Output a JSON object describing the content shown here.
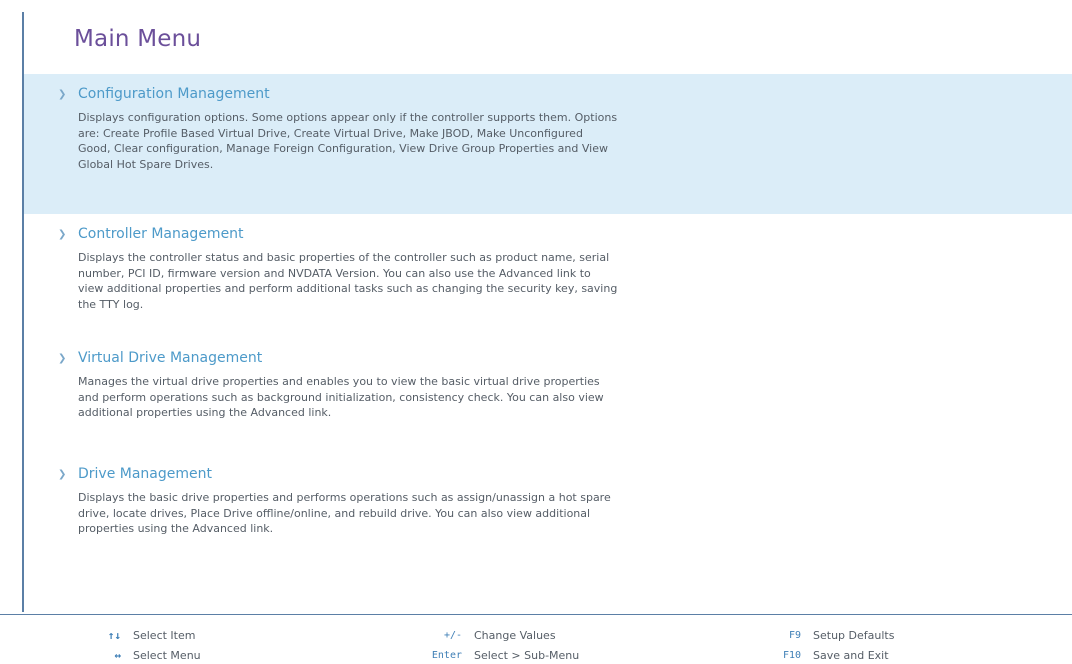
{
  "page": {
    "title": "Main Menu"
  },
  "menu": {
    "items": [
      {
        "label": "Configuration Management",
        "description": "Displays configuration options. Some options appear only if the controller supports them. Options are: Create Profile Based Virtual Drive, Create Virtual Drive, Make JBOD, Make Unconfigured Good, Clear configuration, Manage Foreign Configuration, View Drive Group Properties and View Global Hot Spare Drives.",
        "selected": true
      },
      {
        "label": "Controller Management",
        "description": "Displays the controller status and basic properties of the controller such as product name, serial number, PCI ID, firmware version and NVDATA Version. You can also use the Advanced link to view additional properties and perform additional tasks such as changing the security key, saving the TTY log.",
        "selected": false
      },
      {
        "label": "Virtual Drive Management",
        "description": "Manages the virtual drive properties and enables you to view the basic virtual drive properties and perform operations such as background initialization, consistency check. You can also view additional properties using the Advanced link.",
        "selected": false
      },
      {
        "label": "Drive Management",
        "description": "Displays the basic drive properties and performs operations such as assign/unassign a hot spare drive, locate drives, Place Drive offline/online, and rebuild drive. You can also view additional properties using the Advanced link.",
        "selected": false
      }
    ]
  },
  "footer": {
    "hints": [
      {
        "key": "↑↓",
        "text": "Select Item"
      },
      {
        "key": "↔",
        "text": "Select Menu"
      },
      {
        "key": "+/-",
        "text": "Change Values"
      },
      {
        "key": "Enter",
        "text": "Select > Sub-Menu"
      },
      {
        "key": "F9",
        "text": "Setup Defaults"
      },
      {
        "key": "F10",
        "text": "Save and Exit"
      }
    ]
  },
  "colors": {
    "accent_title": "#6b4f9a",
    "link_blue": "#4d9ac9",
    "selected_bg": "#dbedf8",
    "rule": "#5b7fa6"
  }
}
